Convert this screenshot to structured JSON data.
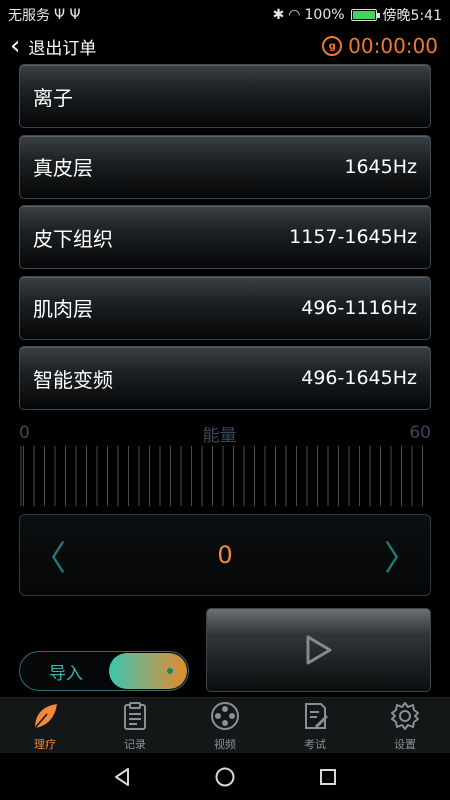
{
  "status_bar": {
    "carrier": "无服务",
    "usb_icons": "Ψ Ψ",
    "battery": "100%",
    "time": "傍晚5:41"
  },
  "header": {
    "back_label": "退出订单",
    "timer": "00:00:00"
  },
  "modes": [
    {
      "name": "离子",
      "freq": ""
    },
    {
      "name": "真皮层",
      "freq": "1645Hz"
    },
    {
      "name": "皮下组织",
      "freq": "1157-1645Hz"
    },
    {
      "name": "肌肉层",
      "freq": "496-1116Hz"
    },
    {
      "name": "智能变频",
      "freq": "496-1645Hz"
    }
  ],
  "energy": {
    "label": "能量",
    "min": "0",
    "max": "60"
  },
  "stepper": {
    "value": "0"
  },
  "import_toggle": {
    "label": "导入"
  },
  "tabs": [
    {
      "label": "理疗",
      "icon": "leaf-icon",
      "active": true
    },
    {
      "label": "记录",
      "icon": "clipboard-icon",
      "active": false
    },
    {
      "label": "视频",
      "icon": "film-reel-icon",
      "active": false
    },
    {
      "label": "考试",
      "icon": "exam-pencil-icon",
      "active": false
    },
    {
      "label": "设置",
      "icon": "gear-icon",
      "active": false
    }
  ],
  "colors": {
    "accent": "#ee8a3a",
    "teal": "#1e7b7e"
  }
}
